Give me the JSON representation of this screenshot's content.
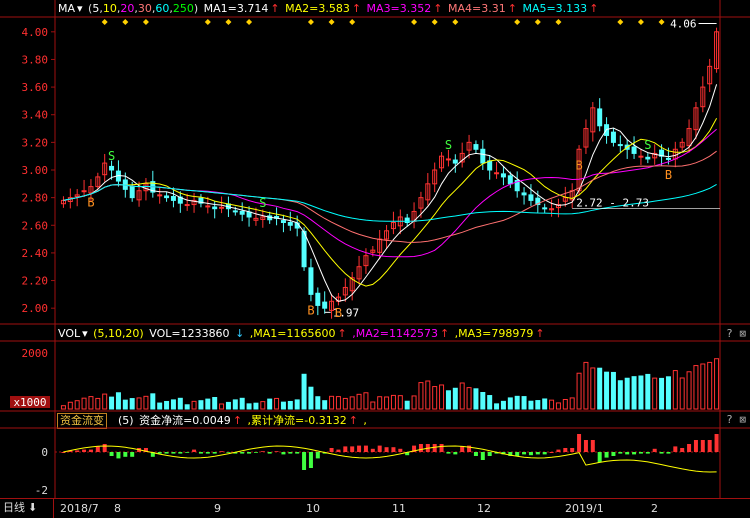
{
  "main_header": {
    "indicator": "MA",
    "params_open": "(",
    "params": [
      "5",
      "10",
      "20",
      "30",
      "60",
      "250"
    ],
    "params_close": ")",
    "ma1": "MA1=3.714",
    "ma2": "MA2=3.583",
    "ma3": "MA3=3.352",
    "ma4": "MA4=3.31",
    "ma5": "MA5=3.133",
    "arrow": "↑"
  },
  "vol_header": {
    "indicator": "VOL",
    "params": "(5,10,20)",
    "vol": "VOL=1233860",
    "down_arrow": "↓",
    "ma1": ",MA1=1165600",
    "ma2": ",MA2=1142573",
    "ma3": ",MA3=798979",
    "arrow": "↑"
  },
  "flow_header": {
    "indicator": "资金流变",
    "params": "(5)",
    "net": "资金净流=0.0049",
    "cum": ",累计净流=-0.3132",
    "tail": ",",
    "arrow": "↑"
  },
  "question_mark": "? ⊠",
  "period_tab": "日线",
  "period_arrow": "⬇",
  "x_labels": [
    "2018/7",
    "8",
    "9",
    "10",
    "11",
    "12",
    "2019/1",
    "2"
  ],
  "vol_axis": {
    "top_label": "2000",
    "unit_label": "x1000"
  },
  "flow_axis": {
    "labels": [
      "0",
      "-2"
    ]
  },
  "price_axis_labels": [
    "4.00",
    "3.80",
    "3.60",
    "3.40",
    "3.20",
    "3.00",
    "2.80",
    "2.60",
    "2.40",
    "2.20",
    "2.00"
  ],
  "annotations": {
    "high": "4.06",
    "low": "1.97",
    "mid": "2.72 - 2.73"
  },
  "signals": [
    "S",
    "B",
    "S",
    "B",
    "B",
    "S",
    "B",
    "S",
    "B"
  ],
  "colors": {
    "up": "#ff3232",
    "down": "#54ffff",
    "ma1": "#ffffff",
    "ma2": "#ffff00",
    "ma3": "#ff00ff",
    "ma4": "#ff7070",
    "ma5": "#00ffff",
    "grid": "#a01010"
  },
  "chart_data": {
    "type": "candlestick",
    "price_range": [
      1.9,
      4.1
    ],
    "closes": [
      2.78,
      2.8,
      2.82,
      2.85,
      2.88,
      2.95,
      3.05,
      3.0,
      2.92,
      2.86,
      2.8,
      2.85,
      2.9,
      2.84,
      2.82,
      2.8,
      2.78,
      2.76,
      2.75,
      2.78,
      2.76,
      2.74,
      2.72,
      2.73,
      2.72,
      2.7,
      2.68,
      2.66,
      2.65,
      2.66,
      2.64,
      2.65,
      2.62,
      2.6,
      2.58,
      2.3,
      2.1,
      2.02,
      2.0,
      2.05,
      2.08,
      2.15,
      2.22,
      2.3,
      2.38,
      2.42,
      2.5,
      2.56,
      2.62,
      2.66,
      2.62,
      2.7,
      2.8,
      2.9,
      3.0,
      3.1,
      3.08,
      3.05,
      3.12,
      3.2,
      3.15,
      3.05,
      3.0,
      2.98,
      2.95,
      2.9,
      2.85,
      2.82,
      2.78,
      2.75,
      2.72,
      2.72,
      2.75,
      2.8,
      2.85,
      3.15,
      3.3,
      3.45,
      3.32,
      3.25,
      3.2,
      3.18,
      3.15,
      3.12,
      3.1,
      3.08,
      3.12,
      3.1,
      3.08,
      3.15,
      3.2,
      3.3,
      3.45,
      3.6,
      3.75,
      4.0
    ]
  }
}
